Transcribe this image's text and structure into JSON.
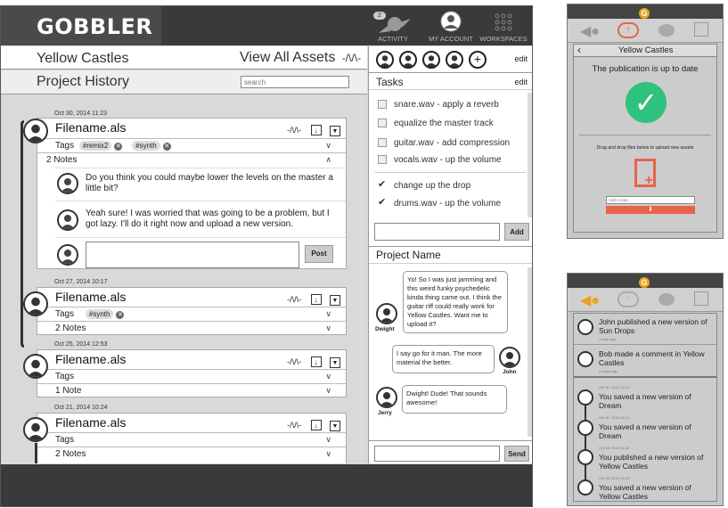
{
  "app": {
    "logo": "GOBBLER",
    "nav": [
      {
        "label": "ACTIVITY",
        "badge": "2"
      },
      {
        "label": "MY ACCOUNT"
      },
      {
        "label": "WORKSPACES"
      }
    ],
    "project_title": "Yellow Castles",
    "view_all_assets": "View All Assets",
    "history_title": "Project History",
    "search_placeholder": "search"
  },
  "history": [
    {
      "date": "Oct 30, 2014 11:23",
      "filename": "Filename.als",
      "tags_label": "Tags",
      "tags": [
        "#remix2",
        "#synth"
      ],
      "notes_label": "2 Notes",
      "notes": [
        "Do you think you could maybe lower the levels on the master a little bit?",
        "Yeah sure! I was worried that was going to be a problem, but I got lazy. I'll do it right now and upload a new version."
      ],
      "post_label": "Post"
    },
    {
      "date": "Oct 27, 2014 10:17",
      "filename": "Filename.als",
      "tags_label": "Tags",
      "tags": [
        "#synth"
      ],
      "notes_label": "2 Notes"
    },
    {
      "date": "Oct 25, 2014 12:53",
      "filename": "Filename.als",
      "tags_label": "Tags",
      "notes_label": "1 Note"
    },
    {
      "date": "Oct 21, 2014 10:24",
      "filename": "Filename.als",
      "tags_label": "Tags",
      "notes_label": "2 Notes"
    }
  ],
  "members": {
    "edit": "edit"
  },
  "tasks": {
    "title": "Tasks",
    "edit": "edit",
    "open": [
      "snare.wav - apply a reverb",
      "equalize the master track",
      "guitar.wav - add compression",
      "vocals.wav - up the volume"
    ],
    "done": [
      "change up the drop",
      "drums.wav - up the volume"
    ],
    "add_label": "Add"
  },
  "chat": {
    "title": "Project Name",
    "messages": [
      {
        "user": "Dwight",
        "text": "Yo! So I was just jamming and this weird funky psychedelic kinda thing came out. I think the guitar riff could really work for Yellow Castles. Want me to upload it?"
      },
      {
        "user": "John",
        "text": "I say go for it man. The more material the better."
      },
      {
        "user": "Jerry",
        "text": "Dwight! Dude! That sounds awesome!"
      }
    ],
    "send_label": "Send"
  },
  "upload_panel": {
    "title": "Yellow Castles",
    "status": "The publication is up to date",
    "instructions": "Drag and drop files below to upload new assets",
    "note_placeholder": "Add a note"
  },
  "activity_panel": {
    "items": [
      {
        "text": "John published a new version of Sun Drops",
        "time": "1 hour ago"
      },
      {
        "text": "Bob made a comment in Yellow Castles",
        "time": "3 hours ago"
      }
    ],
    "timeline": [
      {
        "date": "Oct 30, 2014 11:23",
        "text": "You saved a new version of Dream"
      },
      {
        "date": "Oct 30, 2014 11:13",
        "text": "You saved a new version of Dream"
      },
      {
        "date": "Oct 28, 2014 16:20",
        "text": "You published a new version of Yellow Castles"
      },
      {
        "date": "Oct 28, 2014 13:03",
        "text": "You saved a new version of Yellow Castles"
      }
    ]
  },
  "colors": {
    "accent_orange": "#e8634a",
    "check_green": "#2ec27e",
    "dark_bar": "#3a3a3a",
    "logo_orange": "#e8a317"
  }
}
